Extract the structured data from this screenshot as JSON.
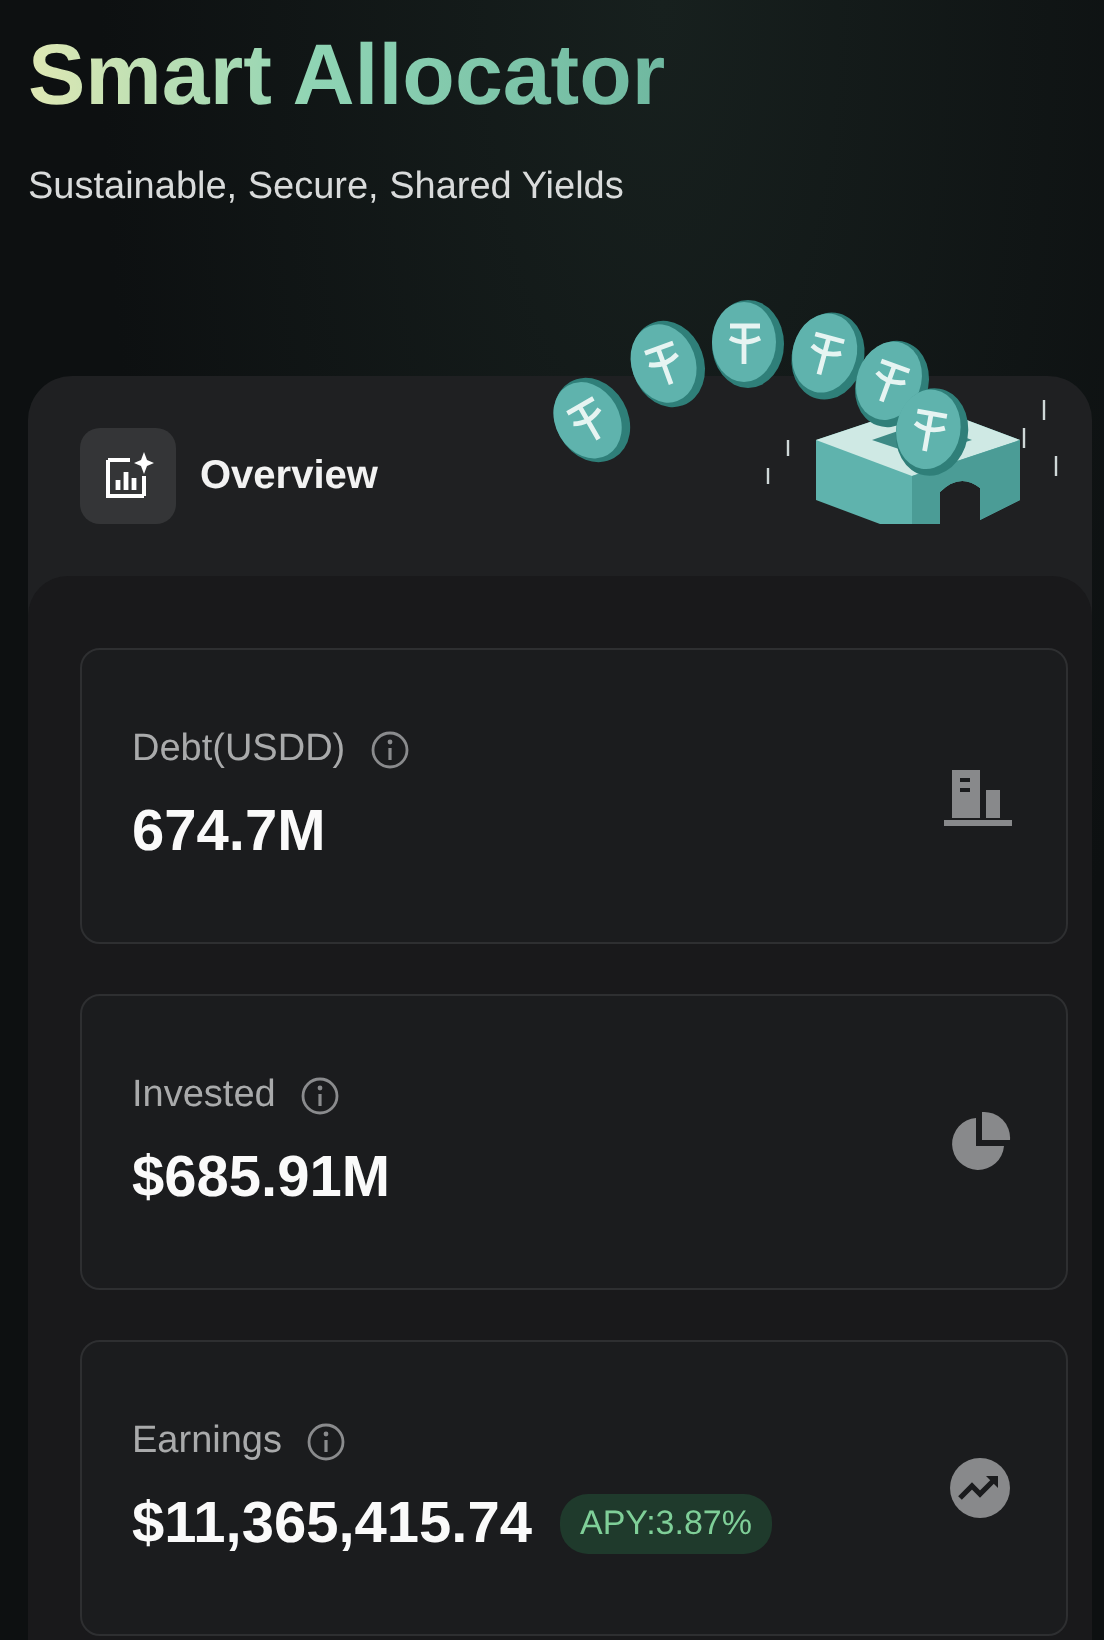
{
  "header": {
    "title": "Smart Allocator",
    "subtitle": "Sustainable, Secure, Shared Yields"
  },
  "overview": {
    "title": "Overview",
    "stats": [
      {
        "kind": "debt",
        "label": "Debt(USDD)",
        "value": "674.7M"
      },
      {
        "kind": "invested",
        "label": "Invested",
        "value": "$685.91M"
      },
      {
        "kind": "earnings",
        "label": "Earnings",
        "value": "$11,365,415.74",
        "badge": "APY:3.87%"
      }
    ]
  }
}
